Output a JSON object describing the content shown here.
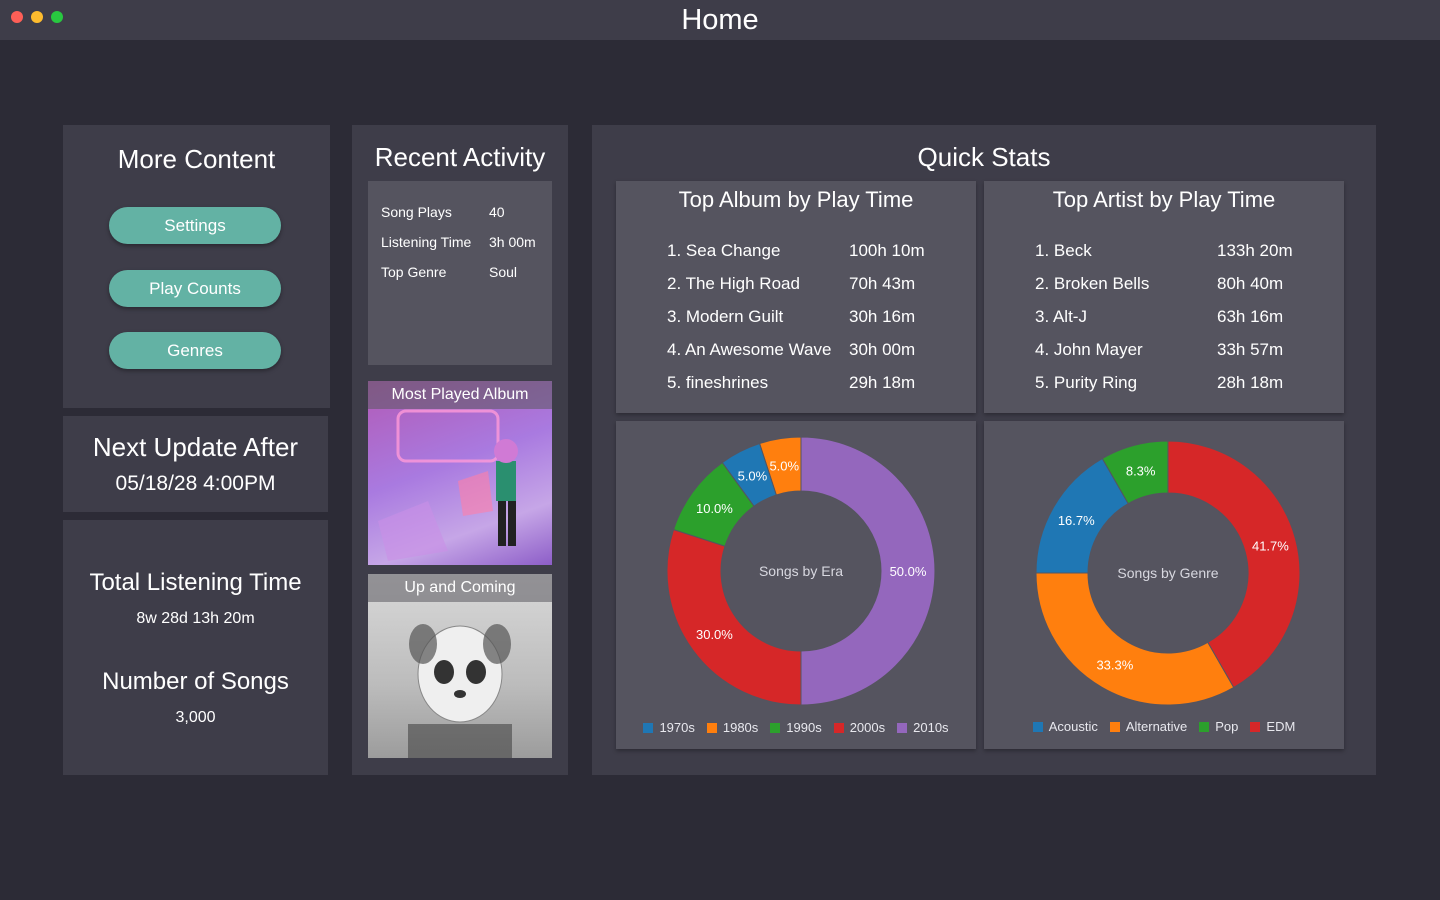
{
  "window": {
    "title": "Home"
  },
  "more_content": {
    "title": "More Content",
    "buttons": [
      "Settings",
      "Play Counts",
      "Genres"
    ]
  },
  "next_update": {
    "heading": "Next Update After",
    "value": "05/18/28 4:00PM"
  },
  "totals": {
    "listening_heading": "Total Listening Time",
    "listening_value": "8w 28d 13h 20m",
    "songs_heading": "Number of Songs",
    "songs_value": "3,000"
  },
  "recent_activity": {
    "title": "Recent Activity",
    "rows": [
      {
        "label": "Song Plays",
        "value": "40"
      },
      {
        "label": "Listening Time",
        "value": "3h 00m"
      },
      {
        "label": "Top Genre",
        "value": "Soul"
      }
    ],
    "most_played_caption": "Most Played Album",
    "up_and_coming_caption": "Up and Coming"
  },
  "quick_stats": {
    "title": "Quick Stats",
    "top_album": {
      "title": "Top Album by Play Time",
      "rows": [
        {
          "name": "1. Sea Change",
          "time": "100h 10m"
        },
        {
          "name": "2. The High Road",
          "time": "70h 43m"
        },
        {
          "name": "3. Modern Guilt",
          "time": "30h 16m"
        },
        {
          "name": "4. An Awesome Wave",
          "time": "30h 00m"
        },
        {
          "name": "5. fineshrines",
          "time": "29h 18m"
        }
      ]
    },
    "top_artist": {
      "title": "Top Artist by Play Time",
      "rows": [
        {
          "name": "1. Beck",
          "time": "133h 20m"
        },
        {
          "name": "2. Broken Bells",
          "time": "80h 40m"
        },
        {
          "name": "3. Alt-J",
          "time": "63h 16m"
        },
        {
          "name": "4. John Mayer",
          "time": "33h 57m"
        },
        {
          "name": "5. Purity Ring",
          "time": "28h 18m"
        }
      ]
    }
  },
  "chart_data": [
    {
      "type": "pie",
      "title": "Songs by Era",
      "categories": [
        "1970s",
        "1980s",
        "1990s",
        "2000s",
        "2010s"
      ],
      "values": [
        5.0,
        5.0,
        10.0,
        30.0,
        50.0
      ],
      "labels": [
        "5.0%",
        "5.0%",
        "10.0%",
        "30.0%",
        "50.0%"
      ],
      "colors": [
        "#1f77b4",
        "#ff7f0e",
        "#2ca02c",
        "#d62728",
        "#9467bd"
      ],
      "legend": "bottom"
    },
    {
      "type": "pie",
      "title": "Songs by Genre",
      "categories": [
        "Acoustic",
        "Alternative",
        "Pop",
        "EDM"
      ],
      "values": [
        16.7,
        33.3,
        8.3,
        41.7
      ],
      "labels": [
        "16.7%",
        "33.3%",
        "8.3%",
        "41.7%"
      ],
      "colors": [
        "#1f77b4",
        "#ff7f0e",
        "#2ca02c",
        "#d62728"
      ],
      "legend": "bottom"
    }
  ]
}
